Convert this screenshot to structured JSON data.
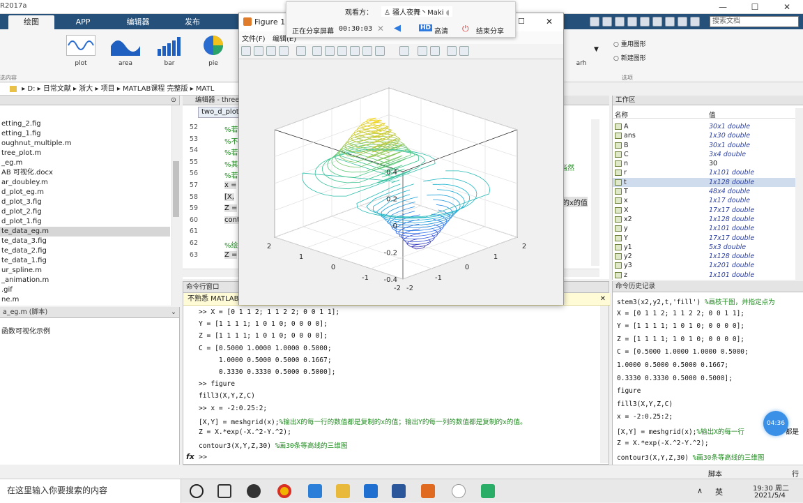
{
  "window": {
    "title": "R2017a",
    "min": "—",
    "max": "☐",
    "close": "✕"
  },
  "ribbon": {
    "tabs": [
      {
        "label": "绘图",
        "selected": true
      },
      {
        "label": "APP",
        "selected": false
      },
      {
        "label": "编辑器",
        "selected": false
      },
      {
        "label": "发布",
        "selected": false
      }
    ],
    "search_placeholder": "搜索文档",
    "plots": [
      {
        "label": "plot",
        "icon": "sine-line-icon"
      },
      {
        "label": "area",
        "icon": "area-plot-icon"
      },
      {
        "label": "bar",
        "icon": "bar-plot-icon"
      },
      {
        "label": "pie",
        "icon": "pie-plot-icon"
      },
      {
        "label": "arh",
        "icon": "plot-gallery-icon"
      }
    ],
    "group_left": "选内容",
    "group_right": "选项",
    "options": [
      "重用图形",
      "新建图形"
    ]
  },
  "path": {
    "drive": "D:",
    "segments": [
      "日常文献",
      "浙大",
      "项目",
      "MATLAB课程 完整版",
      "MATL"
    ]
  },
  "files": {
    "header": "",
    "items": [
      "etting_2.fig",
      "etting_1.fig",
      "oughnut_multiple.m",
      "tree_plot.m",
      "_eg.m",
      "AB 可视化.docx",
      "ar_doubley.m",
      "d_plot_eg.m",
      "d_plot_3.fig",
      "d_plot_2.fig",
      "d_plot_1.fig",
      "te_data_eg.m",
      "te_data_3.fig",
      "te_data_2.fig",
      "te_data_1.fig",
      "ur_spline.m",
      "_animation.m",
      ".gif",
      "ne.m"
    ],
    "selected_index": 11
  },
  "details": {
    "header": "a_eg.m (脚本)",
    "description": "函数可视化示例"
  },
  "editor": {
    "header": "编辑器 - three",
    "tab": "two_d_plot",
    "lines": [
      {
        "num": "52",
        "code": "%若"
      },
      {
        "num": "53",
        "code": "%不"
      },
      {
        "num": "54",
        "code": "%若"
      },
      {
        "num": "55",
        "code": "%其"
      },
      {
        "num": "56",
        "code": "%若"
      },
      {
        "num": "57",
        "code": "x ="
      },
      {
        "num": "58",
        "code": "[X,"
      },
      {
        "num": "59",
        "code": "Z ="
      },
      {
        "num": "60",
        "code": "cont"
      },
      {
        "num": "61",
        "code": ""
      },
      {
        "num": "62",
        "code": "%绘"
      },
      {
        "num": "63",
        "code": "Z ="
      }
    ],
    "right_fragment_1": "，当然",
    "right_fragment_2": "的x的值"
  },
  "command_window": {
    "header": "命令行窗口",
    "notice": "不熟悉 MATLAB",
    "lines": [
      {
        "code": ">> X = [0 1 1 2; 1 1 2 2; 0 0 1 1];",
        "comment": ""
      },
      {
        "code": "Y = [1 1 1 1; 1 0 1 0; 0 0 0 0];",
        "comment": ""
      },
      {
        "code": "Z = [1 1 1 1; 1 0 1 0; 0 0 0 0];",
        "comment": ""
      },
      {
        "code": "C = [0.5000 1.0000 1.0000 0.5000;",
        "comment": ""
      },
      {
        "code": "     1.0000 0.5000 0.5000 0.1667;",
        "comment": ""
      },
      {
        "code": "     0.3330 0.3330 0.5000 0.5000];",
        "comment": ""
      },
      {
        "code": ">> figure",
        "comment": ""
      },
      {
        "code": "fill3(X,Y,Z,C)",
        "comment": ""
      },
      {
        "code": ">> x = -2:0.25:2;",
        "comment": ""
      },
      {
        "code": "[X,Y] = meshgrid(x);",
        "comment": "%输出X的每一行的数值都是复制的x的值；输出Y的每一列的数值都是复制的x的值。"
      },
      {
        "code": "Z = X.*exp(-X.^2-Y.^2);",
        "comment": ""
      },
      {
        "code": "contour3(X,Y,Z,30) ",
        "comment": "%画30条等高线的三维图"
      }
    ],
    "prompt": ">>",
    "fx": "fx"
  },
  "workspace": {
    "header": "工作区",
    "col_name": "名称",
    "col_value": "值",
    "vars": [
      {
        "name": "A",
        "value": "30x1 double"
      },
      {
        "name": "ans",
        "value": "1x30 double"
      },
      {
        "name": "B",
        "value": "30x1 double"
      },
      {
        "name": "C",
        "value": "3x4 double"
      },
      {
        "name": "n",
        "value": "30",
        "plain": true
      },
      {
        "name": "r",
        "value": "1x101 double"
      },
      {
        "name": "t",
        "value": "1x128 double",
        "selected": true
      },
      {
        "name": "T",
        "value": "48x4 double"
      },
      {
        "name": "x",
        "value": "1x17 double"
      },
      {
        "name": "X",
        "value": "17x17 double"
      },
      {
        "name": "x2",
        "value": "1x128 double"
      },
      {
        "name": "y",
        "value": "1x101 double"
      },
      {
        "name": "Y",
        "value": "17x17 double"
      },
      {
        "name": "y1",
        "value": "5x3 double"
      },
      {
        "name": "y2",
        "value": "1x128 double"
      },
      {
        "name": "y3",
        "value": "1x201 double"
      },
      {
        "name": "z",
        "value": "1x101 double"
      }
    ]
  },
  "history": {
    "header": "命令历史记录",
    "lines": [
      {
        "code": "stem3(x2,y2,t,'fill') ",
        "comment": "%画枝干图，并指定点为"
      },
      {
        "code": "X = [0 1 1 2; 1 1 2 2; 0 0 1 1];",
        "comment": ""
      },
      {
        "code": "Y = [1 1 1 1; 1 0 1 0; 0 0 0 0];",
        "comment": ""
      },
      {
        "code": "Z = [1 1 1 1; 1 0 1 0; 0 0 0 0];",
        "comment": ""
      },
      {
        "code": "C = [0.5000 1.0000 1.0000 0.5000;",
        "comment": ""
      },
      {
        "code": "1.0000 0.5000 0.5000 0.1667;",
        "comment": ""
      },
      {
        "code": "0.3330 0.3330 0.5000 0.5000];",
        "comment": ""
      },
      {
        "code": "figure",
        "comment": ""
      },
      {
        "code": "fill3(X,Y,Z,C)",
        "comment": ""
      },
      {
        "code": "x = -2:0.25:2;",
        "comment": ""
      },
      {
        "code": "[X,Y] = meshgrid(x);",
        "comment": "%输出X的每一行"
      },
      {
        "code": "Z = X.*exp(-X.^2-Y.^2);",
        "comment": ""
      },
      {
        "code": "contour3(X,Y,Z,30) ",
        "comment": "%画30条等高线的三维图"
      }
    ],
    "overflow_fragment": "都是",
    "bubble": "04:36"
  },
  "status": {
    "left": "脚本",
    "right": "行"
  },
  "figure": {
    "title": "Figure 1",
    "menu": [
      "文件(F)",
      "编辑(E)"
    ],
    "close": "✕",
    "max": "☐"
  },
  "share": {
    "viewer_label": "观看方：",
    "viewer_name": "骚人夜舞丶Maki",
    "status": "正在分享屏幕",
    "time": "00:30:03",
    "hd": "HD",
    "quality": "高清",
    "end": "结束分享"
  },
  "taskbar": {
    "search_placeholder": "在这里输入你要搜索的内容",
    "time": "19:30 周二",
    "date": "2021/5/4",
    "ime": "英"
  },
  "chart_data": {
    "type": "contour3",
    "function": "Z = X.*exp(-X.^2-Y.^2)",
    "levels": 30,
    "xlim": [
      -2,
      2
    ],
    "ylim": [
      -2,
      2
    ],
    "zlim": [
      -0.4,
      0.4
    ],
    "x_ticks": [
      "-2",
      "-1",
      "0",
      "1",
      "2"
    ],
    "y_ticks": [
      "-2",
      "-1",
      "0",
      "1",
      "2"
    ],
    "z_ticks": [
      "-0.4",
      "-0.2",
      "0",
      "0.2",
      "0.4"
    ],
    "grid": true,
    "colormap": [
      "#3e26a8",
      "#2f6ef0",
      "#13b0d4",
      "#41c88a",
      "#b8c535",
      "#f9d825"
    ]
  }
}
